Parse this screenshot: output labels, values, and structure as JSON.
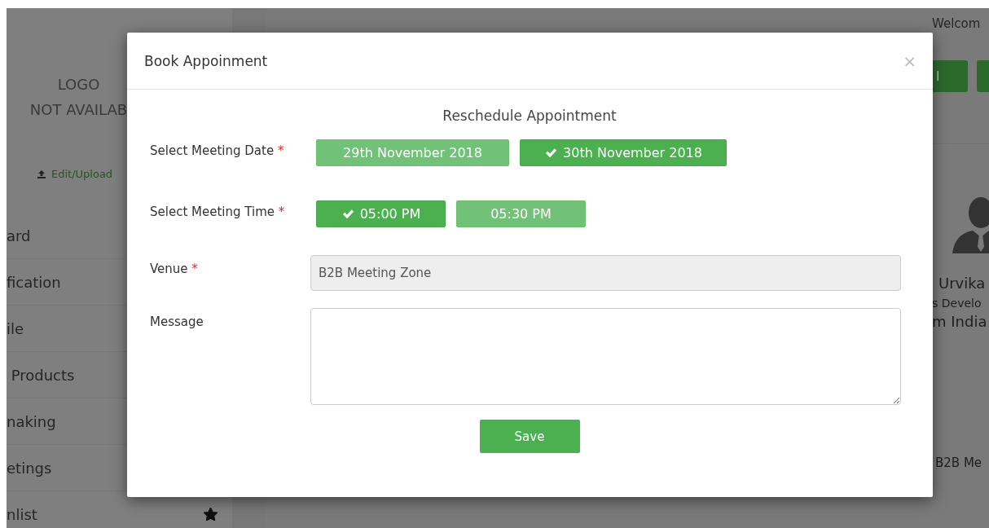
{
  "sidebar": {
    "logo": [
      "LOGO",
      "NOT AVAILAB"
    ],
    "upload_link": "Edit/Upload",
    "items": [
      {
        "label": "ard"
      },
      {
        "label": "fication"
      },
      {
        "label": "ile"
      },
      {
        "label": " Products"
      },
      {
        "label": "naking"
      },
      {
        "label": "etings"
      },
      {
        "label": "nlist",
        "starred": true
      }
    ]
  },
  "header": {
    "welcome": "Welcom",
    "button": "l"
  },
  "profile": {
    "name": "Urvika",
    "role": "s Develo",
    "company": "m India",
    "venue": "B2B Me"
  },
  "modal": {
    "title": "Book Appoinment",
    "close": "×",
    "subtitle": "Reschedule Appointment",
    "date": {
      "label": "Select Meeting Date",
      "required": "*",
      "options": [
        {
          "label": "29th November 2018",
          "selected": false
        },
        {
          "label": "30th November 2018",
          "selected": true
        }
      ]
    },
    "time": {
      "label": "Select Meeting Time",
      "required": "*",
      "options": [
        {
          "label": "05:00 PM",
          "selected": true
        },
        {
          "label": "05:30 PM",
          "selected": false
        }
      ]
    },
    "venue": {
      "label": "Venue",
      "required": "*",
      "value": "B2B Meeting Zone"
    },
    "message": {
      "label": "Message"
    },
    "save": "Save"
  }
}
